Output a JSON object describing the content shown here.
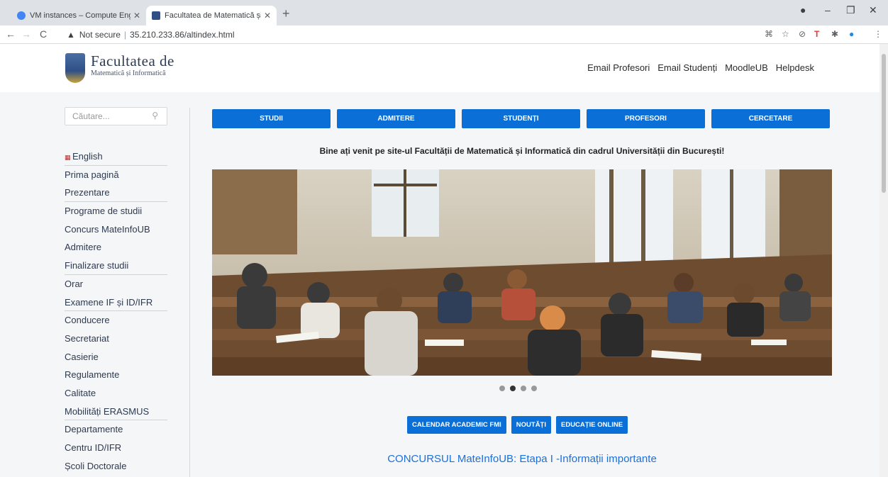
{
  "browser": {
    "tabs": [
      {
        "title": "VM instances – Compute Engine",
        "active": false
      },
      {
        "title": "Facultatea de Matematică și Informatică",
        "active": true
      }
    ],
    "address": {
      "security": "Not secure",
      "url": "35.210.233.86/altindex.html"
    },
    "colors": {
      "tabbar": "#dee1e6",
      "active_tab": "#ffffff"
    }
  },
  "site": {
    "logo": {
      "title": "Facultatea de",
      "subtitle": "Matematică și Informatică"
    },
    "topnav": [
      "Email Profesori",
      "Email Studenți",
      "MoodleUB",
      "Helpdesk"
    ],
    "search": {
      "placeholder": "Căutare..."
    },
    "sidebar": [
      {
        "label": "English",
        "divider": true
      },
      {
        "label": "Prima pagină",
        "divider": false
      },
      {
        "label": "Prezentare",
        "divider": true
      },
      {
        "label": "Programe de studii",
        "divider": false
      },
      {
        "label": "Concurs MateInfoUB",
        "divider": false
      },
      {
        "label": "Admitere",
        "divider": false
      },
      {
        "label": "Finalizare studii",
        "divider": true
      },
      {
        "label": "Orar",
        "divider": false
      },
      {
        "label": "Examene IF și ID/IFR",
        "divider": true
      },
      {
        "label": "Conducere",
        "divider": false
      },
      {
        "label": "Secretariat",
        "divider": false
      },
      {
        "label": "Casierie",
        "divider": false
      },
      {
        "label": "Regulamente",
        "divider": false
      },
      {
        "label": "Calitate",
        "divider": false
      },
      {
        "label": "Mobilități ERASMUS",
        "divider": true
      },
      {
        "label": "Departamente",
        "divider": false
      },
      {
        "label": "Centru ID/IFR",
        "divider": false
      },
      {
        "label": "Școli Doctorale",
        "divider": false
      }
    ],
    "mainnav": [
      "STUDII",
      "ADMITERE",
      "STUDENȚI",
      "PROFESORI",
      "CERCETARE"
    ],
    "welcome": "Bine ați venit pe site-ul Facultății de Matematică și Informatică din cadrul Universității din București!",
    "carousel": {
      "slides": 4,
      "active": 2
    },
    "buttons": [
      "CALENDAR ACADEMIC FMI",
      "NOUTĂȚI",
      "EDUCAȚIE ONLINE"
    ],
    "headline": "CONCURSUL MateInfoUB: Etapa I -Informații importante",
    "colors": {
      "primary": "#0a6fd6",
      "headline": "#1e6fd9",
      "background": "#f4f6f8"
    }
  }
}
